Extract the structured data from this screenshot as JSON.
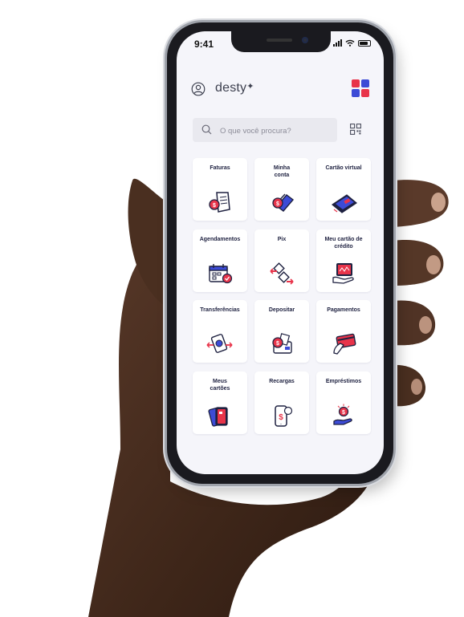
{
  "status_bar": {
    "time": "9:41"
  },
  "header": {
    "brand": "desty",
    "spark_icon": "sparkle-icon"
  },
  "search": {
    "placeholder": "O que você procura?"
  },
  "tiles": [
    {
      "label": "Faturas",
      "icon": "invoice-icon"
    },
    {
      "label": "Minha conta",
      "icon": "account-icon"
    },
    {
      "label": "Cartão virtual",
      "icon": "virtual-card-icon"
    },
    {
      "label": "Agendamentos",
      "icon": "calendar-icon"
    },
    {
      "label": "Pix",
      "icon": "pix-icon"
    },
    {
      "label": "Meu cartão de crédito",
      "icon": "credit-card-icon"
    },
    {
      "label": "Transferências",
      "icon": "transfer-icon"
    },
    {
      "label": "Depositar",
      "icon": "deposit-icon"
    },
    {
      "label": "Pagamentos",
      "icon": "payments-icon"
    },
    {
      "label": "Meus cartões",
      "icon": "my-cards-icon"
    },
    {
      "label": "Recargas",
      "icon": "phone-recharge-icon"
    },
    {
      "label": "Empréstimos",
      "icon": "loan-icon"
    }
  ],
  "colors": {
    "navy": "#1e2140",
    "red": "#e8344a",
    "blue": "#3c4bd6",
    "background": "#f5f5fa",
    "tile": "#ffffff"
  }
}
